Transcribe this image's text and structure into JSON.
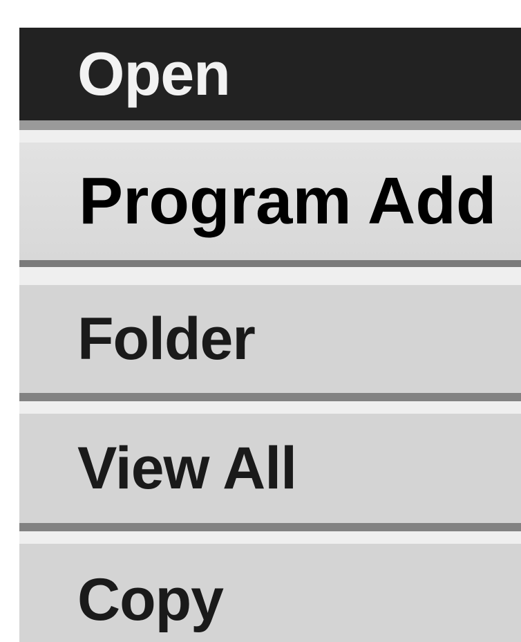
{
  "menu": {
    "items": [
      {
        "label": "Open",
        "state": "selected"
      },
      {
        "label": "Program Add",
        "state": "highlighted"
      },
      {
        "label": "Folder",
        "state": "normal"
      },
      {
        "label": "View All",
        "state": "normal"
      },
      {
        "label": "Copy",
        "state": "normal"
      }
    ]
  },
  "colors": {
    "selected_bg": "#222222",
    "selected_text": "#f2f2f2",
    "item_bg": "#d4d4d4",
    "item_text": "#1a1a1a"
  }
}
